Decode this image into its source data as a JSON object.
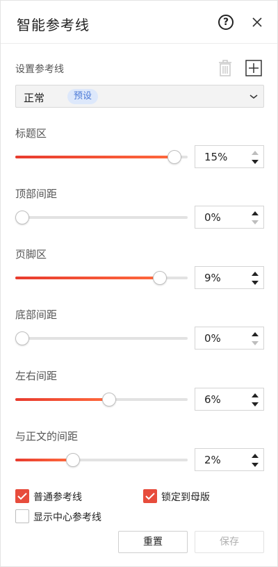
{
  "header": {
    "title": "智能参考线",
    "help_glyph": "?"
  },
  "guides": {
    "label": "设置参考线"
  },
  "preset": {
    "value": "正常",
    "badge": "预设"
  },
  "sliders": [
    {
      "label": "标题区",
      "percent": 15,
      "display": "15%",
      "fill_fraction": 0.96
    },
    {
      "label": "顶部间距",
      "percent": 0,
      "display": "0%",
      "fill_fraction": 0.0
    },
    {
      "label": "页脚区",
      "percent": 9,
      "display": "9%",
      "fill_fraction": 0.87
    },
    {
      "label": "底部间距",
      "percent": 0,
      "display": "0%",
      "fill_fraction": 0.0
    },
    {
      "label": "左右间距",
      "percent": 6,
      "display": "6%",
      "fill_fraction": 0.55
    },
    {
      "label": "与正文的间距",
      "percent": 2,
      "display": "2%",
      "fill_fraction": 0.32
    }
  ],
  "options": {
    "normal_guides": {
      "label": "普通参考线",
      "checked": true
    },
    "lock_master": {
      "label": "锁定到母版",
      "checked": true
    },
    "center_guides": {
      "label": "显示中心参考线",
      "checked": false
    }
  },
  "buttons": {
    "reset": "重置",
    "save": "保存"
  },
  "colors": {
    "accent": "#e74c3c",
    "badge_bg": "#dde8fb",
    "badge_text": "#4a78d6"
  }
}
